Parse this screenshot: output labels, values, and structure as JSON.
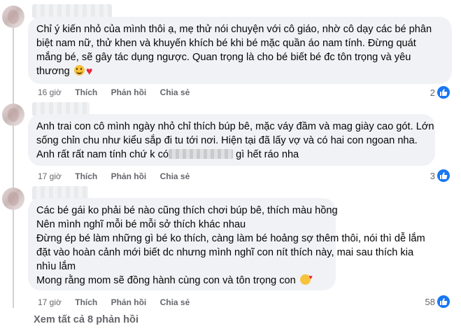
{
  "comments": [
    {
      "lines": [
        "Chỉ ý kiến nhỏ của mình thôi ạ, mẹ thử nói chuyện với cô giáo, nhờ cô dạy các bé phân",
        "biệt nam nữ, thử khen và khuyến khích bé khi bé mặc quần áo nam tính. Đừng quát",
        "mắng bé, sẽ gây tác dụng ngược. Quan trọng là cho bé biết bé đc tôn trọng và yêu",
        "thương"
      ],
      "emoji": [
        "smile",
        "heart"
      ],
      "time": "16 giờ",
      "like": "Thích",
      "reply": "Phản hồi",
      "share": "Chia sẻ",
      "reaction_count": "2"
    },
    {
      "lines": [
        "Anh trai con cô mình ngày nhỏ chỉ thích búp bê, mặc váy đầm và mag giày cao gót. Lớn",
        "sống chỉn chu như kiểu sắp đi tu tới nơi. Hiện tại đã lấy vợ và có hai con ngoan nha.",
        "Anh rất rất nam tính chứ k có",
        "gì hết ráo nha"
      ],
      "time": "17 giờ",
      "like": "Thích",
      "reply": "Phản hồi",
      "share": "Chia sẻ",
      "reaction_count": "3"
    },
    {
      "lines": [
        "Các bé gái ko phải bé nào cũng thích chơi búp bê, thích màu hồng",
        "Nên mình nghĩ mỗi bé mỗi sở thích khác nhau",
        "Đừng ép bé làm những gì bé ko thích, càng làm bé hoảng sợ thêm thôi, nói thì dễ lắm",
        "đặt vào hoàn cảnh mới biết dc nhưng mình nghĩ con nít thích này, mai sau thích kia",
        "nhìu lắm",
        "Mong rằng mom sẽ đồng hành cùng con và tôn trọng con"
      ],
      "emoji": [
        "smiling-face-with-hearts"
      ],
      "time": "17 giờ",
      "like": "Thích",
      "reply": "Phản hồi",
      "share": "Chia sẻ",
      "reaction_count": "58"
    }
  ],
  "see_all": "Xem tất cả 8 phản hồi",
  "colors": {
    "bubble": "#f0f2f5",
    "meta": "#65676b",
    "like_blue": "#1877f2",
    "text": "#050505"
  }
}
